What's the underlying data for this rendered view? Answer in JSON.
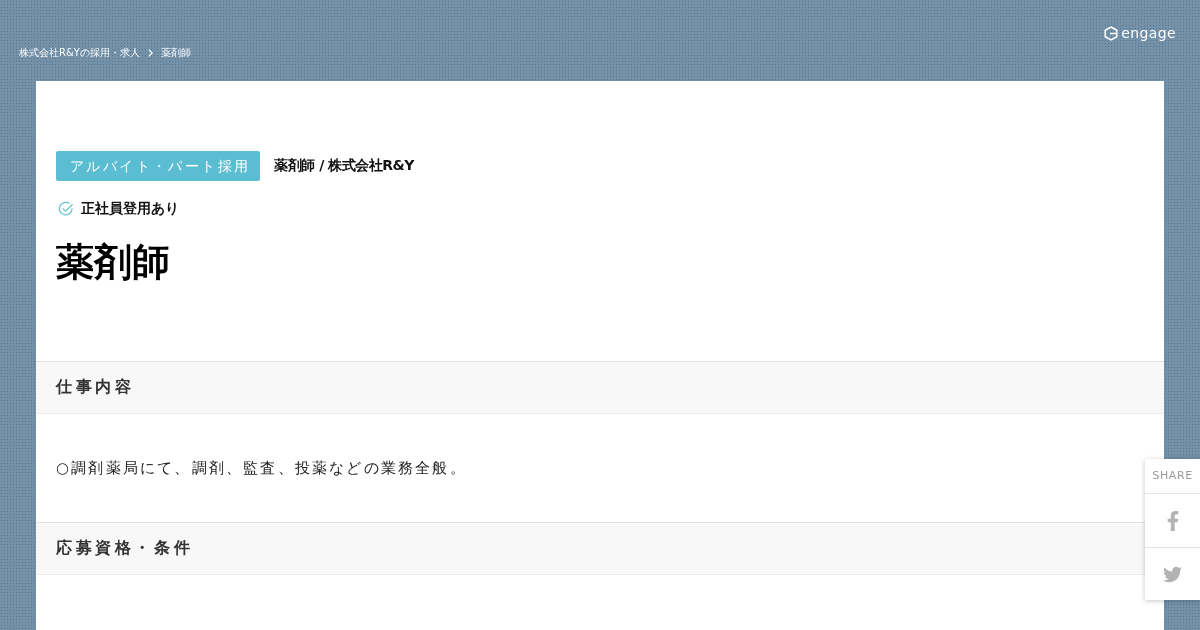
{
  "breadcrumb": [
    {
      "label": "株式会社R&Yの採用・求人"
    },
    {
      "label": "薬剤師"
    }
  ],
  "logo": {
    "text": "engage"
  },
  "job": {
    "employment_tag": "アルバイト・パート採用",
    "subtitle": "薬剤師 / 株式会社R&Y",
    "features": [
      {
        "label": "正社員登用あり"
      }
    ],
    "title": "薬剤師"
  },
  "sections": [
    {
      "heading": "仕事内容",
      "body": "○調剤薬局にて、調剤、監査、投薬などの業務全般。"
    },
    {
      "heading": "応募資格・条件"
    }
  ],
  "share": {
    "label": "SHARE",
    "services": [
      {
        "kind": "facebook"
      },
      {
        "kind": "twitter"
      }
    ]
  }
}
